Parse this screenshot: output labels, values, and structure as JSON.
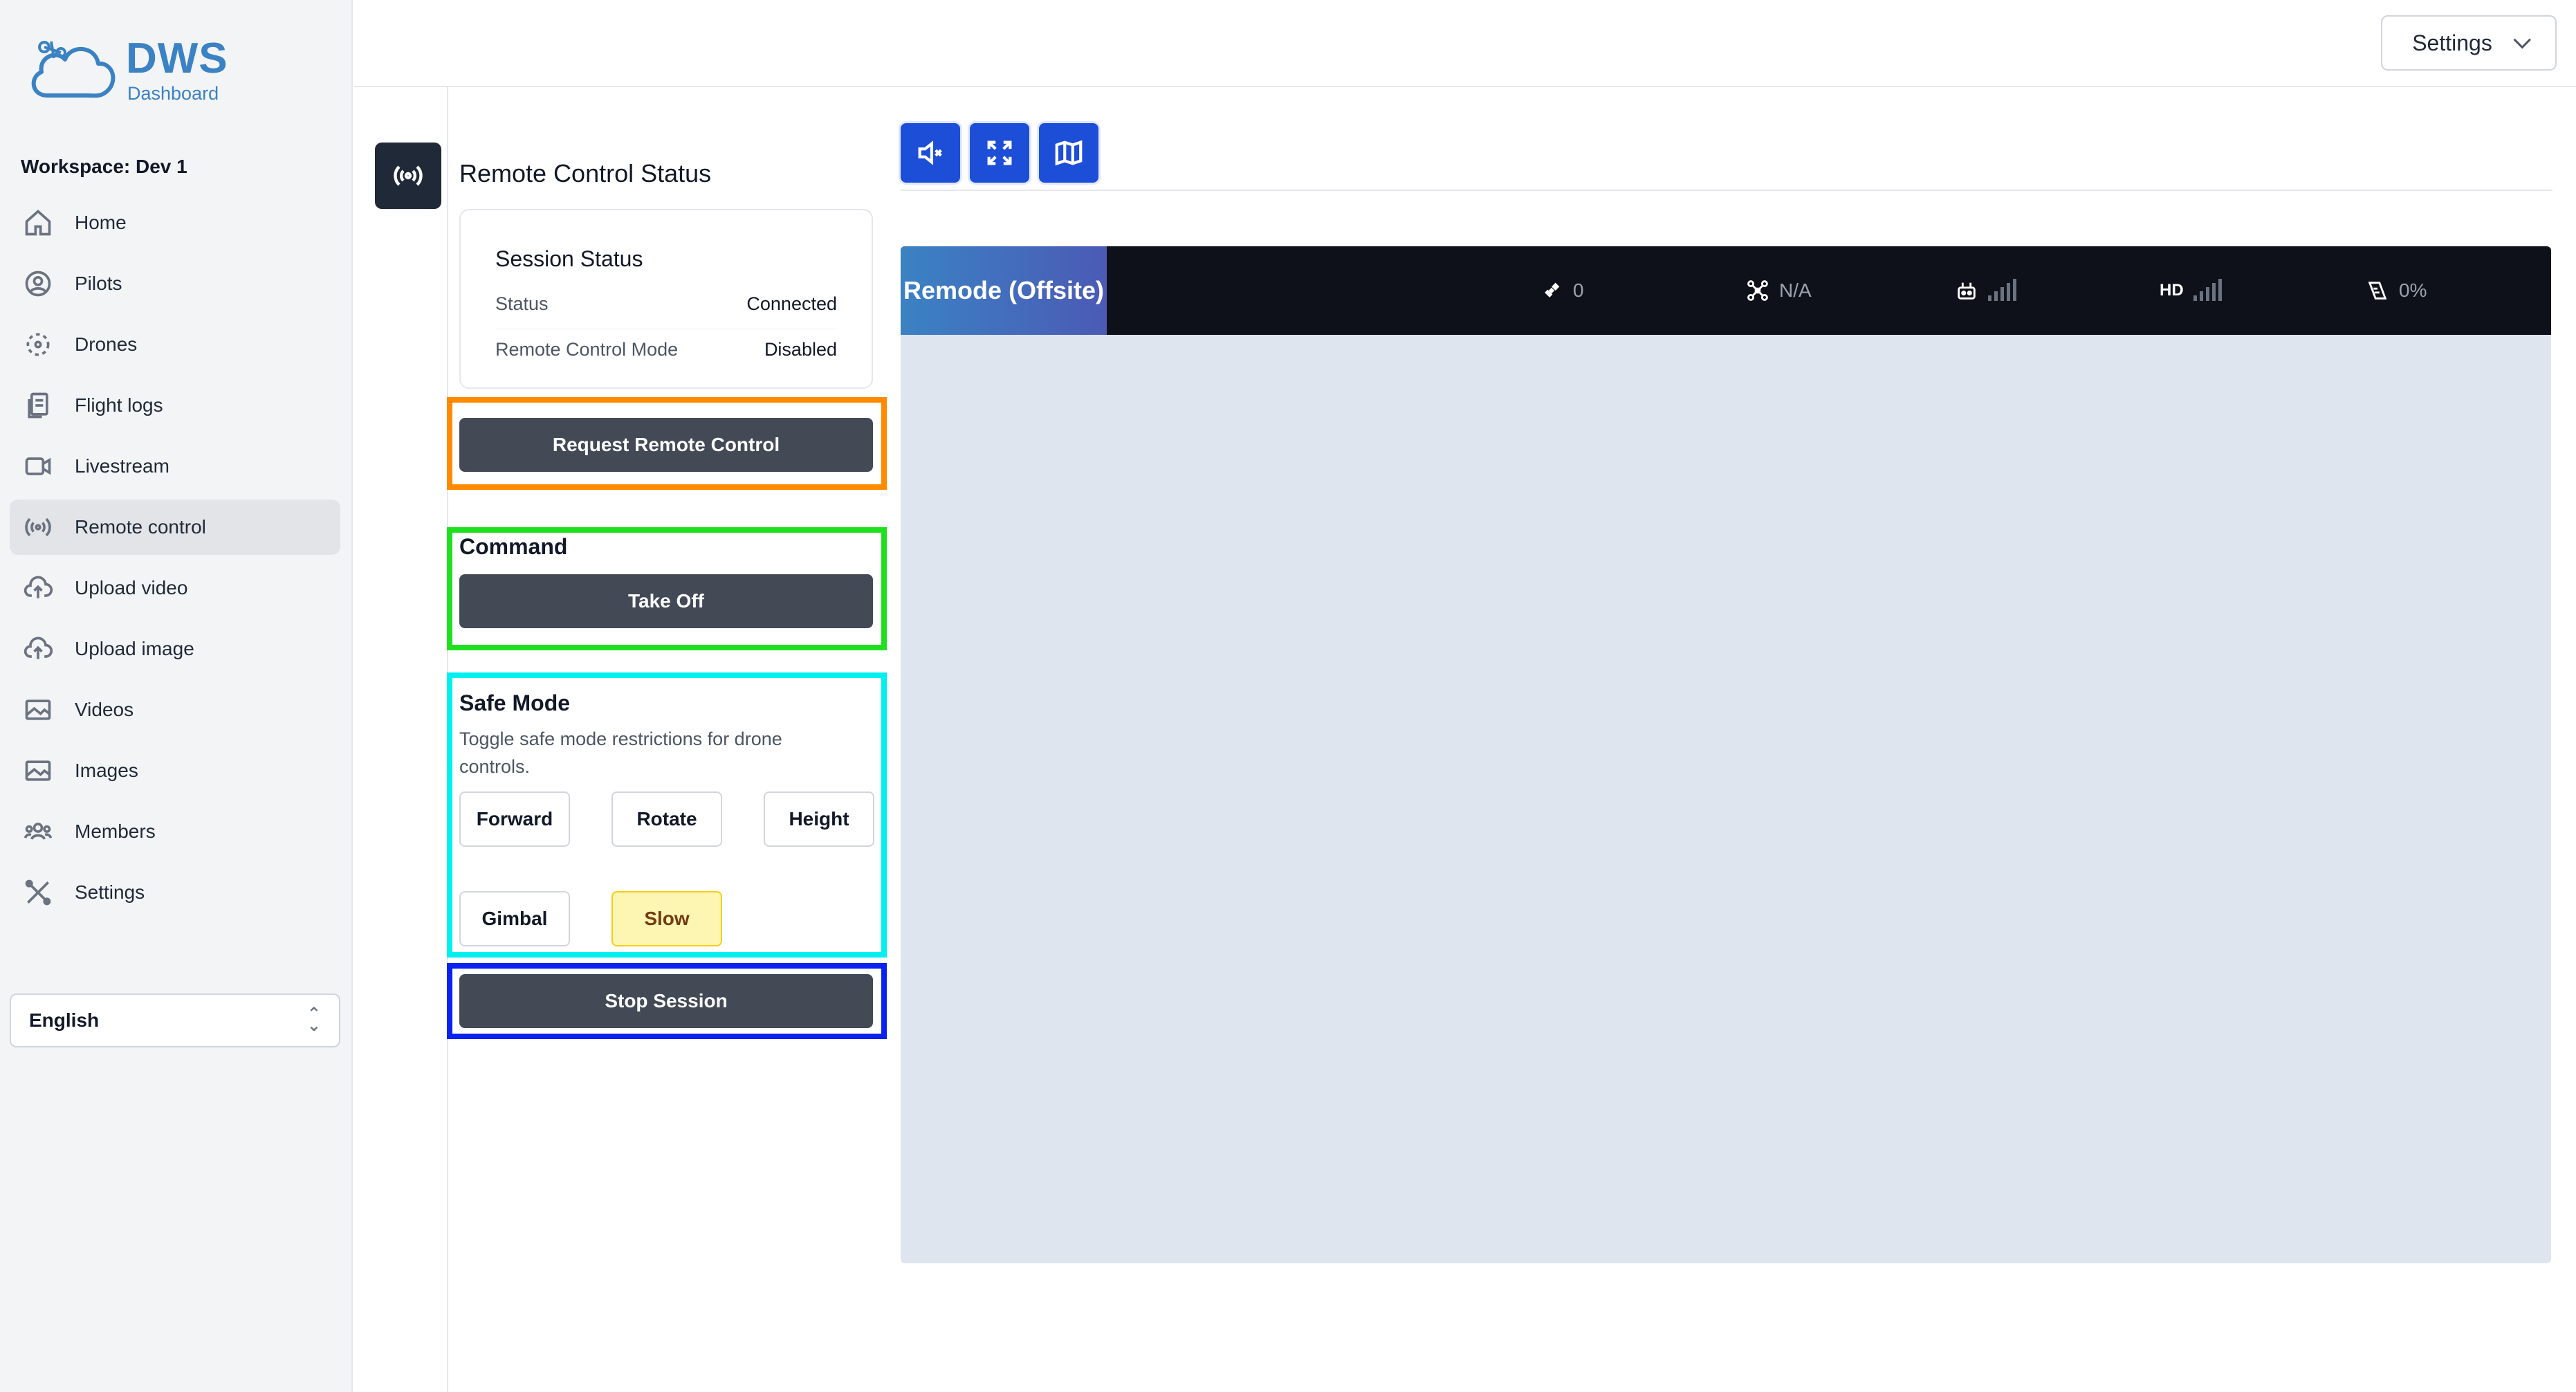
{
  "app": {
    "logo_title": "DWS",
    "logo_subtitle": "Dashboard",
    "workspace": "Workspace: Dev 1"
  },
  "sidebar": {
    "items": [
      {
        "label": "Home",
        "icon": "home-icon"
      },
      {
        "label": "Pilots",
        "icon": "user-circle-icon"
      },
      {
        "label": "Drones",
        "icon": "drone-icon"
      },
      {
        "label": "Flight logs",
        "icon": "document-icon"
      },
      {
        "label": "Livestream",
        "icon": "video-camera-icon"
      },
      {
        "label": "Remote control",
        "icon": "broadcast-icon",
        "active": true
      },
      {
        "label": "Upload video",
        "icon": "cloud-upload-icon"
      },
      {
        "label": "Upload image",
        "icon": "cloud-upload-icon"
      },
      {
        "label": "Videos",
        "icon": "image-icon"
      },
      {
        "label": "Images",
        "icon": "image-icon"
      },
      {
        "label": "Members",
        "icon": "users-icon"
      },
      {
        "label": "Settings",
        "icon": "tools-icon"
      }
    ],
    "language": "English"
  },
  "topbar": {
    "settings_label": "Settings"
  },
  "panel": {
    "title": "Remote Control Status",
    "session": {
      "title": "Session Status",
      "status_label": "Status",
      "status_value": "Connected",
      "mode_label": "Remote Control Mode",
      "mode_value": "Disabled"
    },
    "request_button": "Request Remote Control",
    "command_label": "Command",
    "takeoff_button": "Take Off",
    "safe_mode": {
      "title": "Safe Mode",
      "description": "Toggle safe mode restrictions for drone controls.",
      "buttons": {
        "forward": "Forward",
        "rotate": "Rotate",
        "height": "Height",
        "gimbal": "Gimbal",
        "slow": "Slow"
      }
    },
    "stop_button": "Stop Session"
  },
  "video": {
    "toolbar_icons": [
      "mute-icon",
      "fullscreen-icon",
      "map-icon"
    ],
    "device_name": "Remode (Offsite)",
    "satellite_count": "0",
    "drone_status": "N/A",
    "hd_label": "HD",
    "battery": "0%"
  },
  "colors": {
    "accent_blue": "#1d4ed8",
    "dark_button": "#434a56",
    "highlight_orange": "#ff8a00",
    "highlight_green": "#1fe01f",
    "highlight_cyan": "#00f0f0",
    "highlight_blue": "#0a22f0",
    "slow_active": "#fdf6b2"
  }
}
